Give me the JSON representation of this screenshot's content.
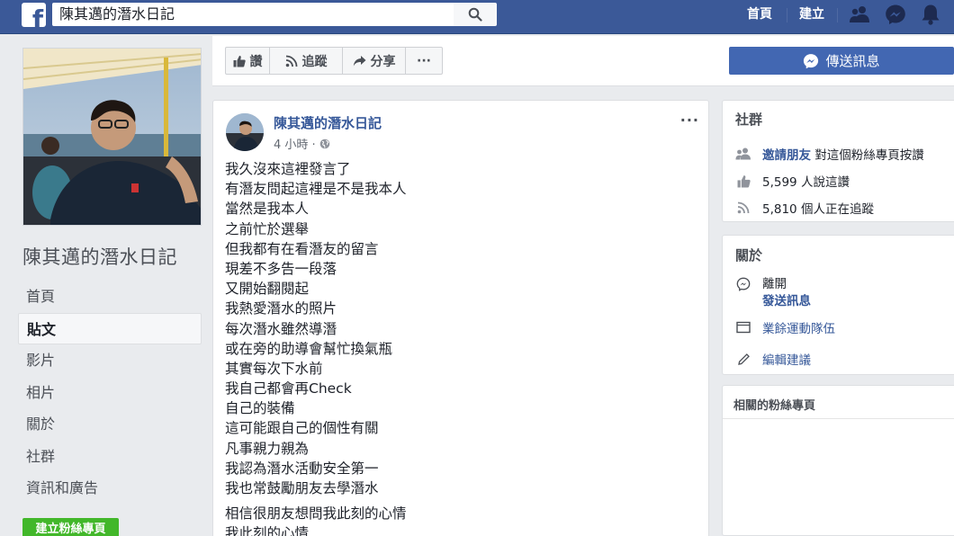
{
  "topbar": {
    "logo": "f",
    "search_value": "陳其邁的潛水日記",
    "nav_home": "首頁",
    "nav_create": "建立",
    "icons": [
      "search-icon",
      "friends-icon",
      "messenger-icon",
      "notifications-icon"
    ]
  },
  "left": {
    "page_name": "陳其邁的潛水日記",
    "nav_items": [
      {
        "label": "首頁",
        "active": false
      },
      {
        "label": "貼文",
        "active": true
      },
      {
        "label": "影片",
        "active": false
      },
      {
        "label": "相片",
        "active": false
      },
      {
        "label": "關於",
        "active": false
      },
      {
        "label": "社群",
        "active": false
      },
      {
        "label": "資訊和廣告",
        "active": false
      }
    ],
    "create_page": "建立粉絲專頁"
  },
  "actions": {
    "like": "讚",
    "follow": "追蹤",
    "share": "分享",
    "more": "···",
    "send_message": "傳送訊息"
  },
  "post": {
    "author": "陳其邁的潛水日記",
    "time": "4 小時 ·",
    "more": "···",
    "lines": [
      "我久沒來這裡發言了",
      "有潛友問起這裡是不是我本人",
      "當然是我本人",
      "之前忙於選舉",
      "但我都有在看潛友的留言",
      "現差不多告一段落",
      "又開始翻閱起",
      "我熱愛潛水的照片",
      "每次潛水雖然導潛",
      "或在旁的助導會幫忙換氣瓶",
      "其實每次下水前",
      "我自己都會再Check",
      "自己的裝備",
      "這可能跟自己的個性有關",
      "凡事親力親為",
      "我認為潛水活動安全第一",
      "我也常鼓勵朋友去學潛水"
    ],
    "lines2": [
      "相信很朋友想問我此刻的心情",
      "我此刻的心情"
    ]
  },
  "community": {
    "title": "社群",
    "invite_link": "邀請朋友",
    "invite_text": "對這個粉絲專頁按讚",
    "likes": "5,599 人說這讚",
    "follows": "5,810 個人正在追蹤"
  },
  "about": {
    "title": "關於",
    "msg_line1": "離開",
    "msg_line2": "發送訊息",
    "category": "業餘運動隊伍",
    "edit": "編輯建議"
  },
  "related": {
    "title": "相關的粉絲專頁"
  },
  "colors": {
    "brand": "#3b5998",
    "link": "#365899",
    "button_blue": "#4267b2",
    "green": "#42b72a",
    "background": "#e9ebee"
  }
}
